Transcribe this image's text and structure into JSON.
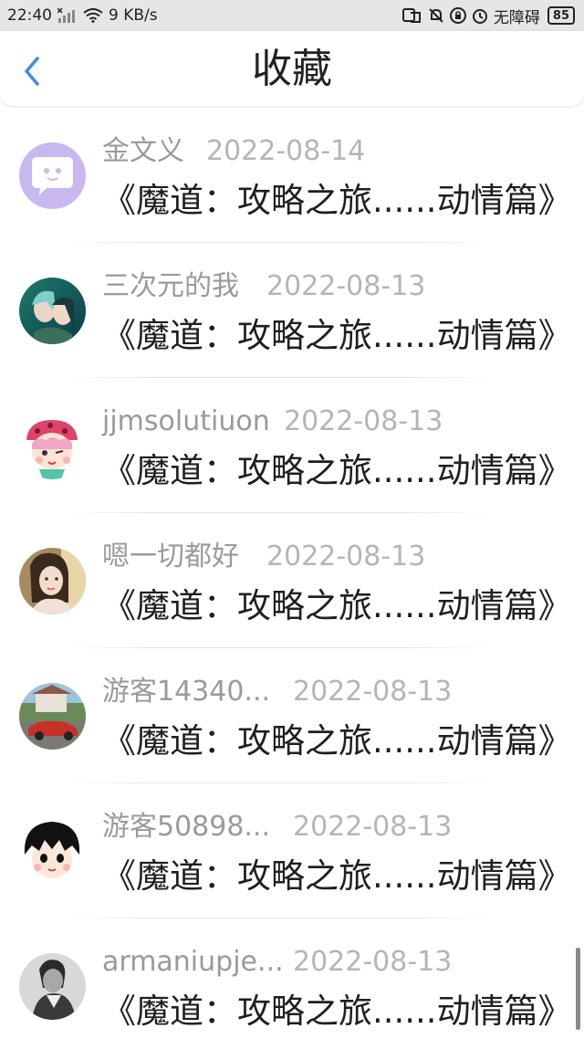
{
  "status_bar": {
    "time": "22:40",
    "network_speed": "9 KB/s",
    "accessibility_text": "无障碍",
    "battery": "85"
  },
  "header": {
    "title": "收藏",
    "back_icon": "chevron-left-icon"
  },
  "items": [
    {
      "username": "金文义",
      "date": "2022-08-14",
      "title": "《魔道：攻略之旅......动情篇》",
      "avatar": "default-chat-avatar"
    },
    {
      "username": "三次元的我",
      "date": "2022-08-13",
      "title": "《魔道：攻略之旅......动情篇》",
      "avatar": "anime-couple-avatar"
    },
    {
      "username": "jjmsolutiuon",
      "date": "2022-08-13",
      "title": "《魔道：攻略之旅......动情篇》",
      "avatar": "cartoon-girl-avatar"
    },
    {
      "username": "嗯一切都好",
      "date": "2022-08-13",
      "title": "《魔道：攻略之旅......动情篇》",
      "avatar": "photo-woman-avatar"
    },
    {
      "username": "游客14340...",
      "date": "2022-08-13",
      "title": "《魔道：攻略之旅......动情篇》",
      "avatar": "car-photo-avatar"
    },
    {
      "username": "游客50898...",
      "date": "2022-08-13",
      "title": "《魔道：攻略之旅......动情篇》",
      "avatar": "cartoon-boy-avatar"
    },
    {
      "username": "armaniupje...",
      "date": "2022-08-13",
      "title": "《魔道：攻略之旅......动情篇》",
      "avatar": "bw-photo-avatar"
    }
  ],
  "colors": {
    "accent": "#3a8ee6",
    "status_bar_bg": "#e6e6e6",
    "username": "#9a9a9a",
    "date": "#b5b5b5"
  }
}
